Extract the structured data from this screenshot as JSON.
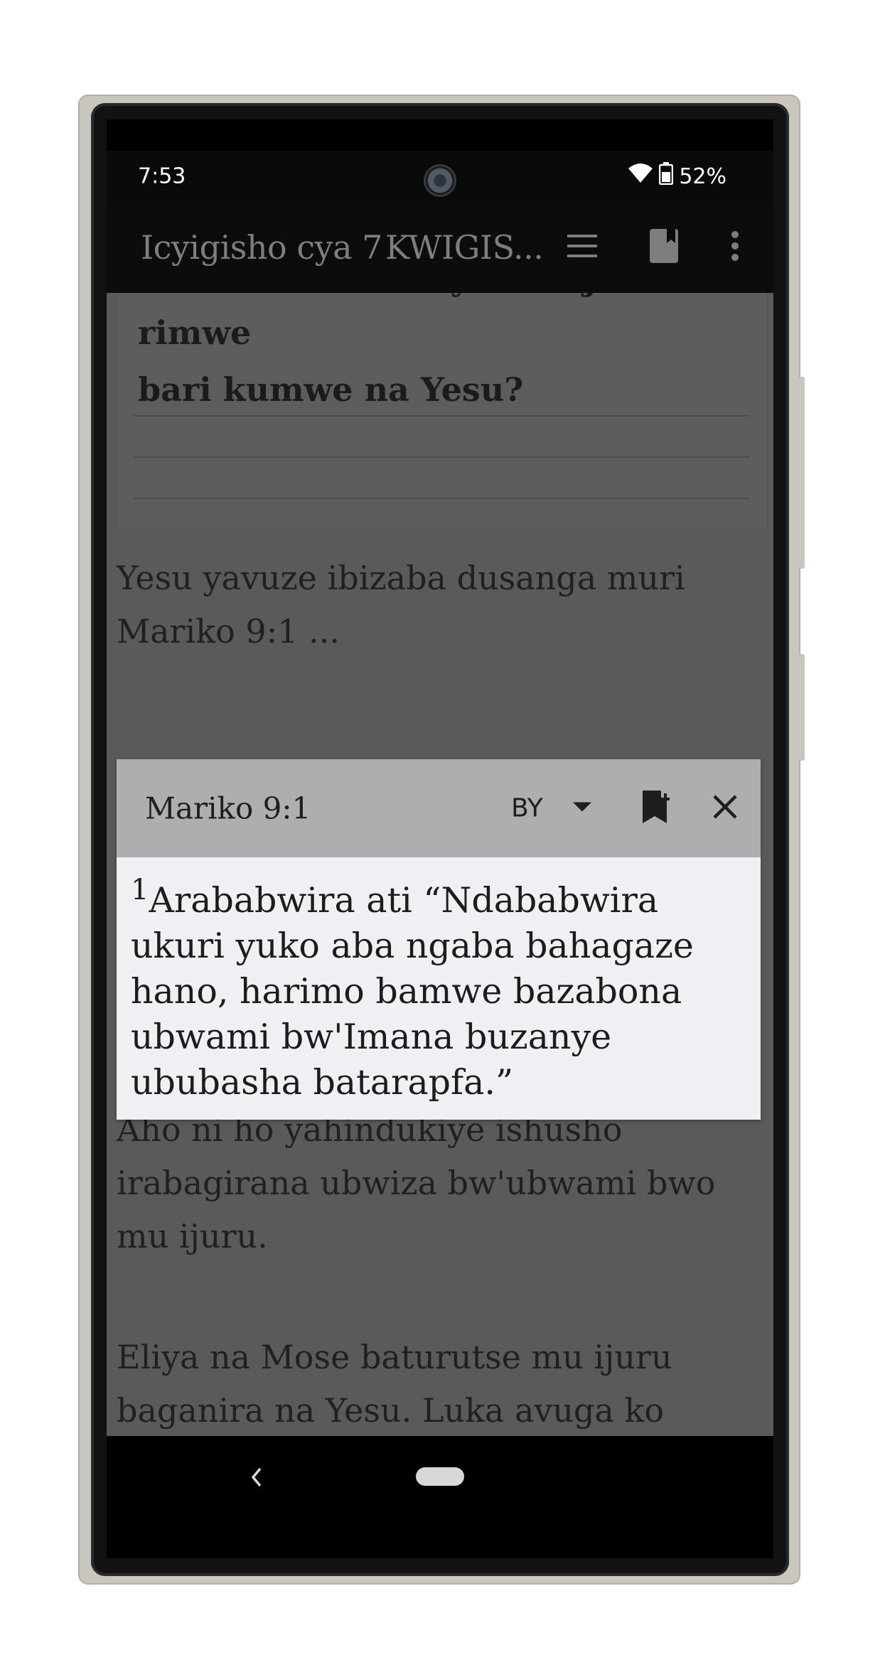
{
  "status": {
    "time": "7:53",
    "battery": "52%"
  },
  "app_bar": {
    "title": "Icyigisho cya 7",
    "subtitle": "KWIGIS..."
  },
  "content": {
    "question_lines": [
      "na Yohana babonye mu ijoro rimwe",
      "bari kumwe na Yesu?"
    ],
    "para1_line1": "Yesu yavuze ibizaba dusanga muri",
    "para1_line2": "Mariko 9:1 ...",
    "para2": "Aho ni ho yahindukiye ishusho irabagirana ubwiza bw'ubwami bwo mu ijuru.",
    "para3": "Eliya na Mose baturutse mu ijuru baganira na Yesu. Luka avuga ko baganiraga ku byaríbigiye kuba kuri Yesu, ko yari agiye gusiga intumwa ze agasohoza umurimo wamuzanye i"
  },
  "popup": {
    "reference": "Mariko 9:1",
    "version": "BY",
    "verse_number": "1",
    "verse_text": "Arababwira ati “Ndababwira ukuri yuko aba ngaba bahagaze hano, harimo bamwe bazabona ubwami bw'Imana buzanye ububasha batarapfa.”"
  },
  "colors": {
    "overlay": "#5a5a5a",
    "popup_header": "#adaeb0",
    "popup_body": "#eff0f3"
  }
}
